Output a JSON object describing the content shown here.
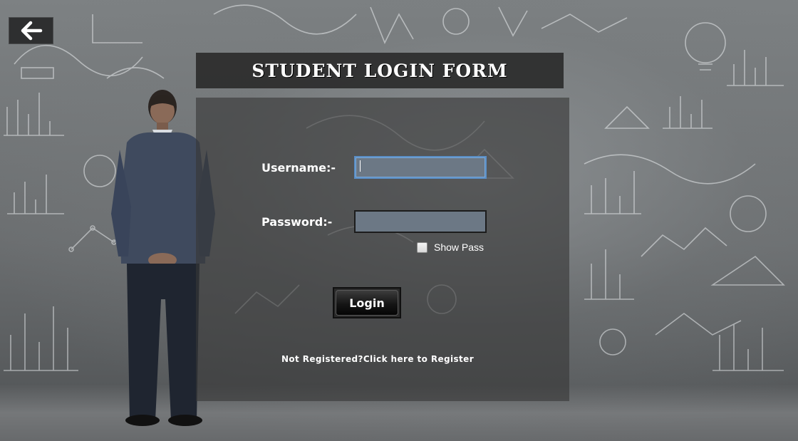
{
  "form": {
    "title": "STUDENT LOGIN FORM",
    "username_label": "Username:-",
    "username_value": "",
    "password_label": "Password:-",
    "password_value": "",
    "show_pass_label": "Show Pass",
    "show_pass_checked": false,
    "login_label": "Login",
    "register_link": "Not Registered?Click here to Register"
  },
  "navigation": {
    "back_icon": "arrow-left-icon"
  },
  "colors": {
    "panel_bg": "#373737",
    "input_bg": "#6c7885",
    "focus_border": "#5b8fc6",
    "text": "#ffffff"
  }
}
